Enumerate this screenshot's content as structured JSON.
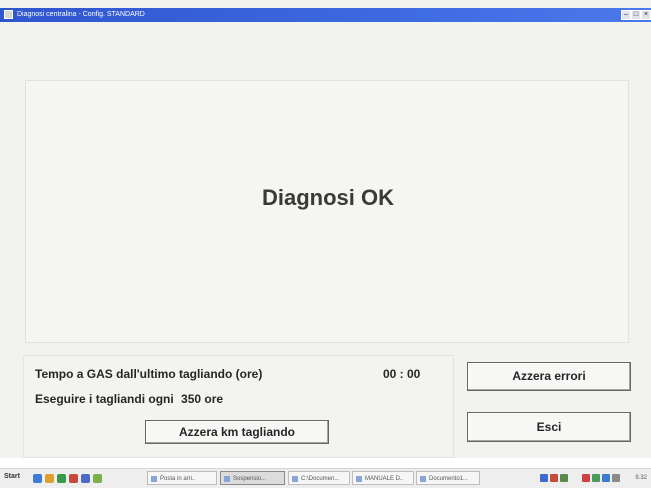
{
  "window": {
    "title": "Diagnosi centralina - Config. STANDARD"
  },
  "main": {
    "status_text": "Diagnosi OK"
  },
  "info": {
    "gas_time_label": "Tempo a GAS dall'ultimo tagliando (ore)",
    "gas_time_value": "00 : 00",
    "service_interval_label": "Eseguire i tagliandi ogni",
    "service_interval_value": "350",
    "service_interval_unit": "ore",
    "reset_km_button": "Azzera km tagliando"
  },
  "actions": {
    "reset_errors_button": "Azzera errori",
    "exit_button": "Esci"
  },
  "taskbar": {
    "start_label": "Start",
    "items": [
      "Posta in arri..",
      "Sospensio...",
      "C:\\Documen...",
      "MANUALE D..",
      "Documento1..."
    ],
    "clock": "9.32"
  },
  "colors": {
    "titlebar": "#3d6ae0",
    "window_bg": "#f2f2ef",
    "text": "#262626"
  }
}
